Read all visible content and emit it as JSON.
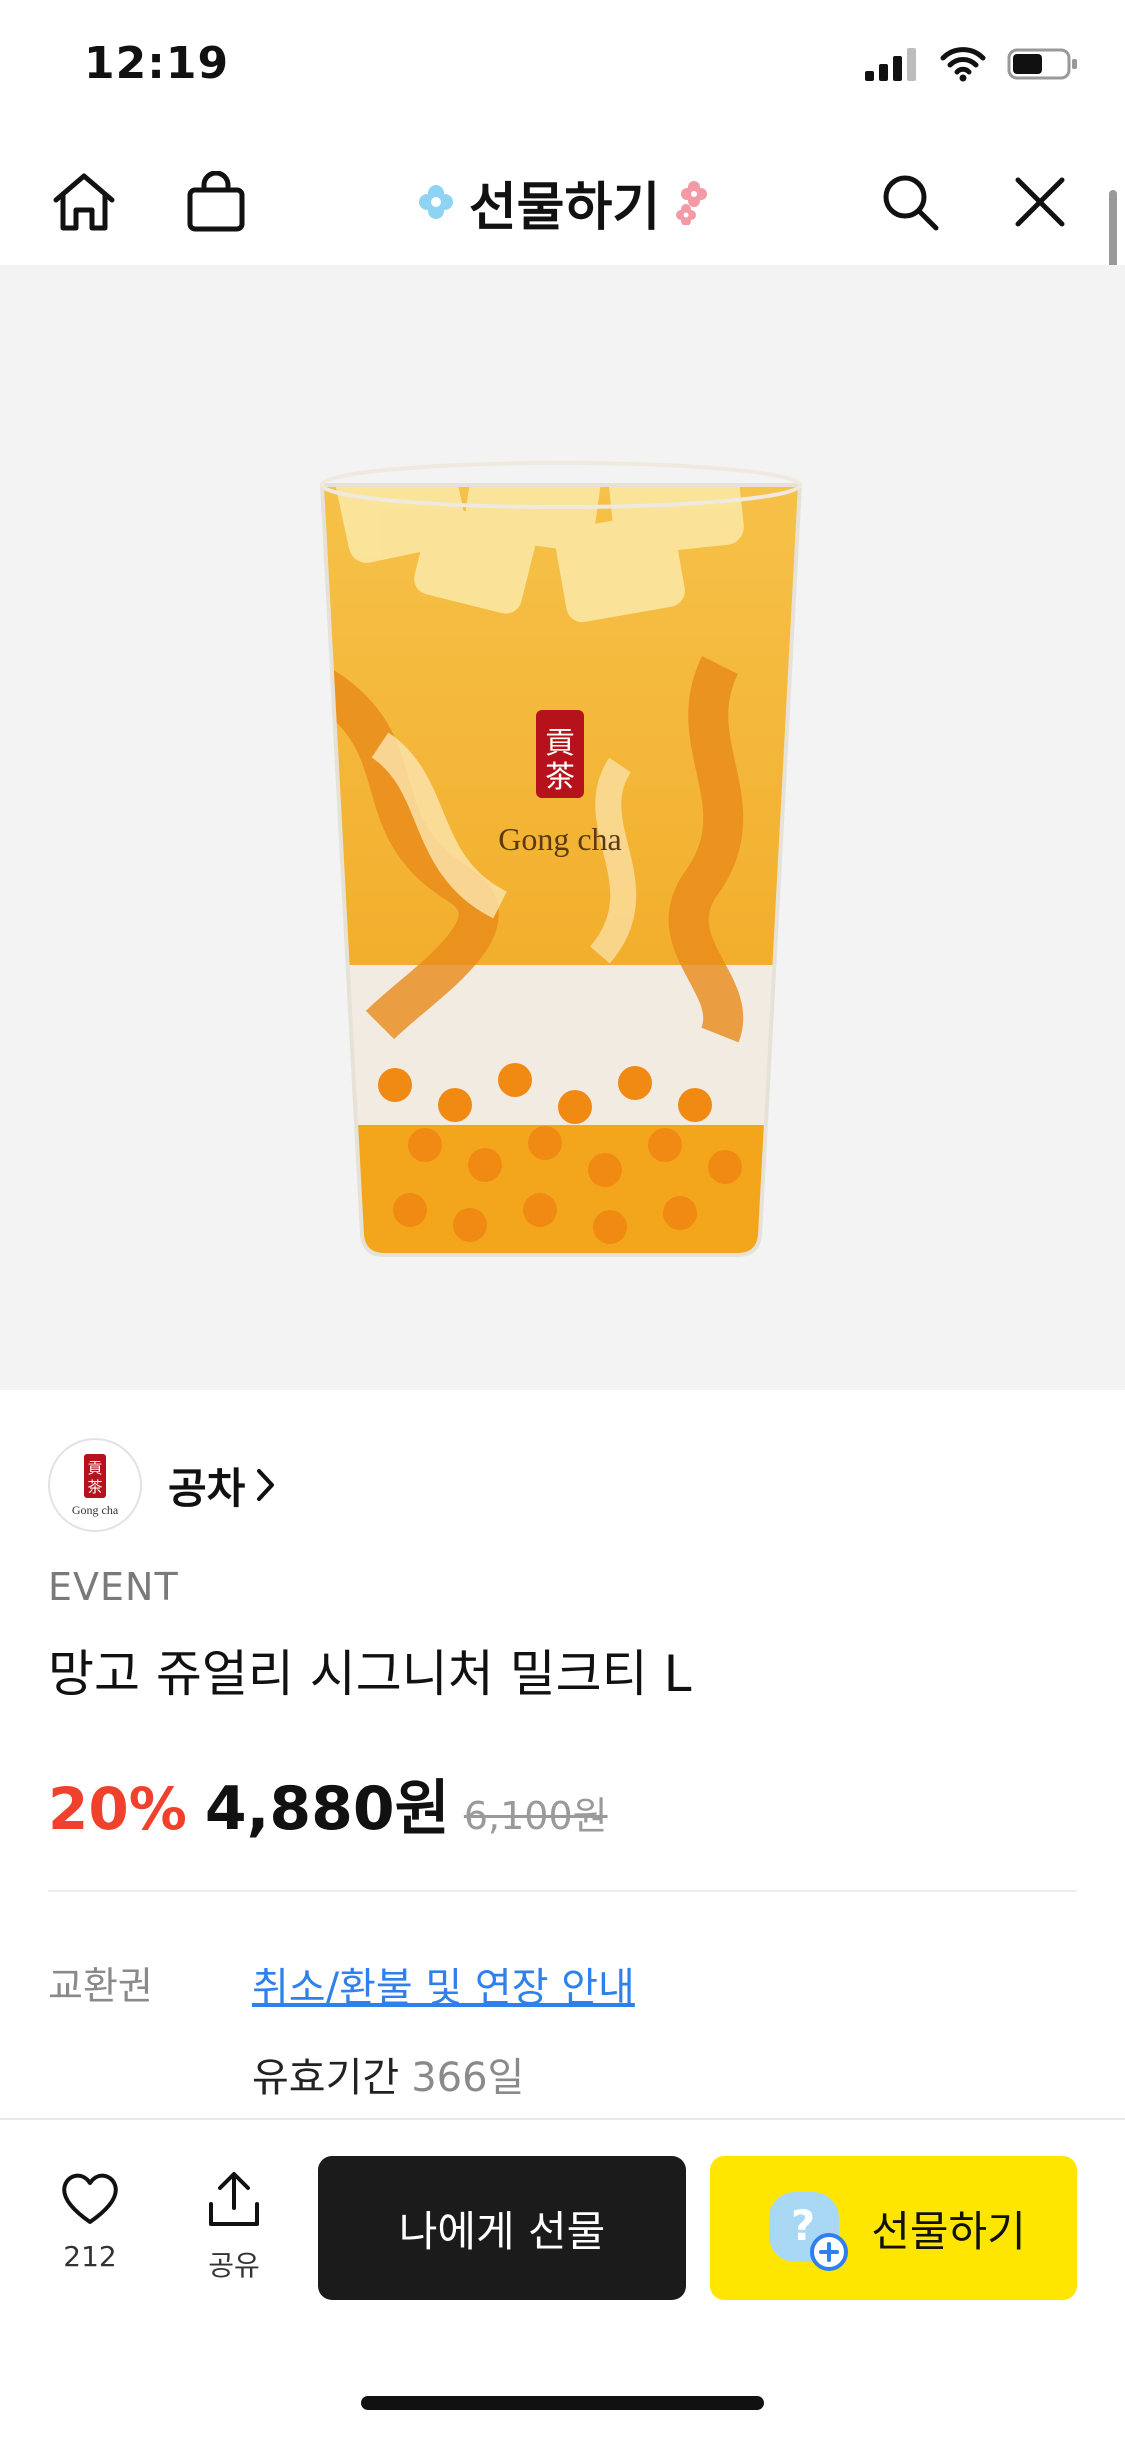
{
  "status_bar": {
    "time": "12:19",
    "battery_level": 0.55
  },
  "nav": {
    "title": "선물하기"
  },
  "product": {
    "image_logo_text": "Gong cha",
    "brand_name": "공차",
    "event_label": "EVENT",
    "title": "망고 쥬얼리 시그니처 밀크티 L",
    "discount": "20%",
    "price": "4,880원",
    "original_price": "6,100원"
  },
  "info": {
    "label": "교환권",
    "link_text": "취소/환불 및 연장 안내",
    "validity_label": "유효기간",
    "validity_value": "366일"
  },
  "bottom_bar": {
    "like_count": "212",
    "share_label": "공유",
    "gift_self_label": "나에게 선물",
    "gift_label": "선물하기"
  },
  "colors": {
    "accent_yellow": "#ffe600",
    "discount_red": "#f0412d",
    "link_blue": "#2f80ed",
    "dark_button": "#1b1b1b"
  }
}
